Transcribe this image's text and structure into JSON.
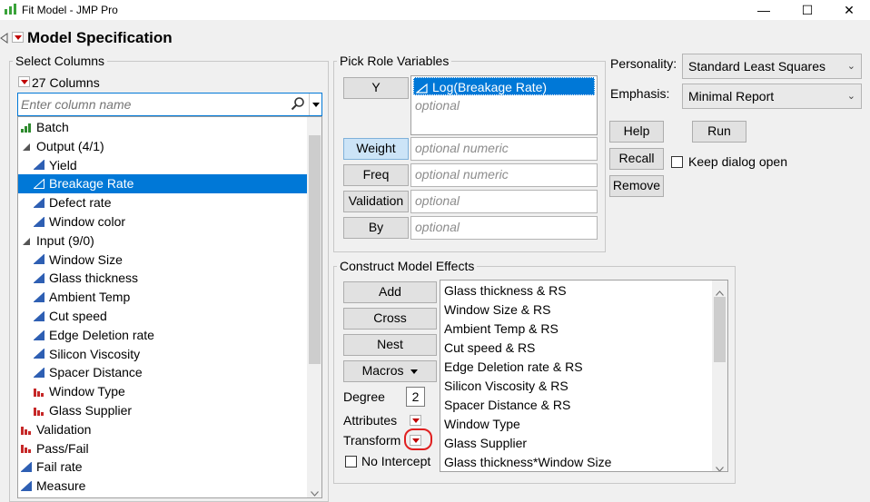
{
  "window": {
    "title": "Fit Model - JMP Pro",
    "minimize": "—",
    "maximize": "☐",
    "close": "✕"
  },
  "header": {
    "title": "Model Specification"
  },
  "select_columns": {
    "label": "Select Columns",
    "count": "27 Columns",
    "search_placeholder": "Enter column name",
    "items": [
      {
        "label": "Batch",
        "icon": "bar-icon",
        "indent": 0
      },
      {
        "label": "Output (4/1)",
        "icon": "group-disclosure",
        "indent": 0
      },
      {
        "label": "Yield",
        "icon": "continuous-icon",
        "indent": 1
      },
      {
        "label": "Breakage Rate",
        "icon": "continuous-icon",
        "indent": 1,
        "selected": true
      },
      {
        "label": "Defect rate",
        "icon": "continuous-icon",
        "indent": 1
      },
      {
        "label": "Window color",
        "icon": "continuous-icon",
        "indent": 1
      },
      {
        "label": "Input (9/0)",
        "icon": "group-disclosure",
        "indent": 0
      },
      {
        "label": "Window Size",
        "icon": "continuous-icon",
        "indent": 1
      },
      {
        "label": "Glass thickness",
        "icon": "continuous-icon",
        "indent": 1
      },
      {
        "label": "Ambient  Temp",
        "icon": "continuous-icon",
        "indent": 1
      },
      {
        "label": "Cut speed",
        "icon": "continuous-icon",
        "indent": 1
      },
      {
        "label": "Edge Deletion rate",
        "icon": "continuous-icon",
        "indent": 1
      },
      {
        "label": "Silicon Viscosity",
        "icon": "continuous-icon",
        "indent": 1
      },
      {
        "label": "Spacer Distance",
        "icon": "continuous-icon",
        "indent": 1
      },
      {
        "label": "Window Type",
        "icon": "nominal-icon",
        "indent": 1
      },
      {
        "label": "Glass Supplier",
        "icon": "nominal-icon",
        "indent": 1
      },
      {
        "label": "Validation",
        "icon": "nominal-icon",
        "indent": 0
      },
      {
        "label": "Pass/Fail",
        "icon": "nominal-icon",
        "indent": 0
      },
      {
        "label": "Fail rate",
        "icon": "continuous-icon",
        "indent": 0
      },
      {
        "label": "Measure",
        "icon": "continuous-icon",
        "indent": 0
      }
    ]
  },
  "pick_role": {
    "label": "Pick Role Variables",
    "y_button": "Y",
    "y_value": "Log(Breakage Rate)",
    "y_optional": "optional",
    "weight_button": "Weight",
    "weight_placeholder": "optional numeric",
    "freq_button": "Freq",
    "freq_placeholder": "optional numeric",
    "validation_button": "Validation",
    "validation_placeholder": "optional",
    "by_button": "By",
    "by_placeholder": "optional"
  },
  "settings": {
    "personality_label": "Personality:",
    "personality_value": "Standard Least Squares",
    "emphasis_label": "Emphasis:",
    "emphasis_value": "Minimal Report",
    "help": "Help",
    "run": "Run",
    "recall": "Recall",
    "keep_open": "Keep dialog open",
    "remove": "Remove"
  },
  "construct": {
    "label": "Construct Model Effects",
    "add": "Add",
    "cross": "Cross",
    "nest": "Nest",
    "macros": "Macros",
    "degree_label": "Degree",
    "degree_value": "2",
    "attributes": "Attributes",
    "transform": "Transform",
    "no_intercept": "No Intercept",
    "effects": [
      "Glass thickness & RS",
      "Window Size & RS",
      "Ambient  Temp & RS",
      "Cut speed & RS",
      "Edge Deletion rate & RS",
      "Silicon Viscosity & RS",
      "Spacer Distance & RS",
      "Window Type",
      "Glass Supplier",
      "Glass thickness*Window Size"
    ]
  }
}
